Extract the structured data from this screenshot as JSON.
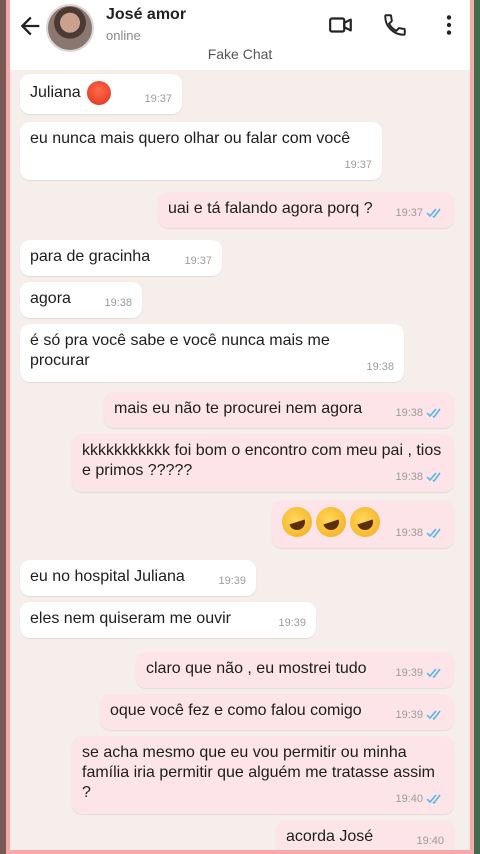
{
  "header": {
    "contact_name": "José amor",
    "status": "online",
    "subtitle": "Fake Chat"
  },
  "colors": {
    "incoming_bubble": "#ffffff",
    "outgoing_bubble": "#fce4e8",
    "frame": "#f5a9a8",
    "read_ticks": "#4fb6ec"
  },
  "messages": [
    {
      "dir": "in",
      "text": "Juliana",
      "emoji": "angry-face",
      "time": "19:37"
    },
    {
      "dir": "in",
      "text": "eu nunca mais quero olhar ou falar com você",
      "time": "19:37"
    },
    {
      "dir": "out",
      "text": "uai e tá falando agora porq ?",
      "time": "19:37"
    },
    {
      "dir": "in",
      "text": "para de gracinha",
      "time": "19:37"
    },
    {
      "dir": "in",
      "text": "agora",
      "time": "19:38"
    },
    {
      "dir": "in",
      "text": "é só pra você sabe e você nunca mais me procurar",
      "time": "19:38"
    },
    {
      "dir": "out",
      "text": "mais eu não te procurei nem agora",
      "time": "19:38"
    },
    {
      "dir": "out",
      "text": "kkkkkkkkkkk foi bom o encontro com meu pai , tios e primos ?????",
      "time": "19:38"
    },
    {
      "dir": "out",
      "text": "",
      "emoji": "rolling-laughing x3",
      "time": "19:38"
    },
    {
      "dir": "in",
      "text": "eu no hospital Juliana",
      "time": "19:39"
    },
    {
      "dir": "in",
      "text": "eles nem quiseram me ouvir",
      "time": "19:39"
    },
    {
      "dir": "out",
      "text": "claro que não , eu mostrei tudo",
      "time": "19:39"
    },
    {
      "dir": "out",
      "text": "oque você fez e como falou comigo",
      "time": "19:39"
    },
    {
      "dir": "out",
      "text": "se acha mesmo que eu vou permitir ou minha família iria permitir que alguém me tratasse assim ?",
      "time": "19:40"
    },
    {
      "dir": "out",
      "text": "acorda José",
      "time": "19:40"
    }
  ]
}
